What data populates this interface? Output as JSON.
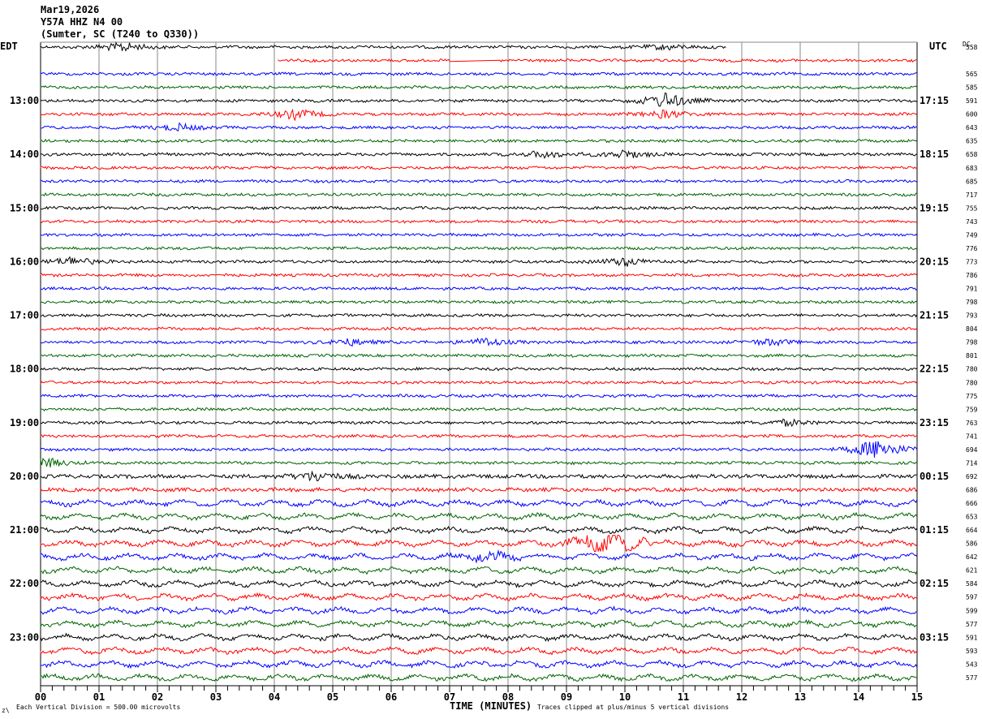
{
  "chart_data": {
    "type": "line",
    "title_lines": [
      "Mar19,2026",
      "Y57A HHZ N4 00",
      "(Sumter, SC (T240 to Q330))"
    ],
    "left_timezone": "EDT",
    "right_timezone": "UTC",
    "dc_label": "DC",
    "xlabel": "TIME (MINUTES)",
    "x_ticks": [
      "00",
      "01",
      "02",
      "03",
      "04",
      "05",
      "06",
      "07",
      "08",
      "09",
      "10",
      "11",
      "12",
      "13",
      "14",
      "15"
    ],
    "xlim": [
      0,
      15
    ],
    "trace_count": 48,
    "trace_minutes": 15,
    "trace_colors": [
      "#000000",
      "#ff0000",
      "#0000ff",
      "#006400"
    ],
    "left_hour_labels": [
      "13:00",
      "14:00",
      "15:00",
      "16:00",
      "17:00",
      "18:00",
      "19:00",
      "20:00",
      "21:00",
      "22:00",
      "23:00"
    ],
    "right_hour_labels": [
      "17:15",
      "18:15",
      "19:15",
      "20:15",
      "21:15",
      "22:15",
      "23:15",
      "00:15",
      "01:15",
      "02:15",
      "03:15"
    ],
    "dc_offsets": [
      "558",
      "",
      "565",
      "585",
      "591",
      "600",
      "643",
      "635",
      "658",
      "683",
      "685",
      "717",
      "755",
      "743",
      "749",
      "776",
      "773",
      "786",
      "791",
      "798",
      "793",
      "804",
      "798",
      "801",
      "780",
      "780",
      "775",
      "759",
      "763",
      "741",
      "694",
      "714",
      "692",
      "686",
      "666",
      "653",
      "664",
      "586",
      "642",
      "621",
      "584",
      "597",
      "599",
      "577",
      "591",
      "593",
      "543",
      "577"
    ],
    "scale_note": "Each Vertical Division =  500.00 microvolts",
    "clip_note": "Traces clipped at plus/minus 5 vertical divisions",
    "corner_mark": "z\\"
  }
}
